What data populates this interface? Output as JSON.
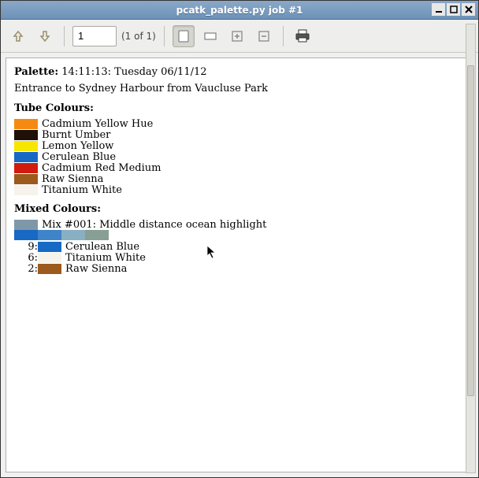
{
  "window": {
    "title": "pcatk_palette.py job #1"
  },
  "toolbar": {
    "page_value": "1",
    "page_count_label": "(1 of 1)"
  },
  "doc": {
    "palette_prefix": "Palette:",
    "timestamp": "14:11:13: Tuesday 06/11/12",
    "subtitle": "Entrance to Sydney Harbour from Vaucluse Park",
    "tube_heading": "Tube Colours:",
    "tube_colours": [
      {
        "name": "Cadmium Yellow Hue",
        "hex": "#f58a13"
      },
      {
        "name": "Burnt Umber",
        "hex": "#1f1108"
      },
      {
        "name": "Lemon Yellow",
        "hex": "#f6e600"
      },
      {
        "name": "Cerulean Blue",
        "hex": "#1769c4"
      },
      {
        "name": "Cadmium Red Medium",
        "hex": "#d11b0f"
      },
      {
        "name": "Raw Sienna",
        "hex": "#9c5a1d"
      },
      {
        "name": "Titanium White",
        "hex": "#f5f3ec"
      }
    ],
    "mixed_heading": "Mixed Colours:",
    "mix_label": "Mix #001: Middle distance ocean highlight",
    "mix_swatch_hex": "#7f98a9",
    "gradient": [
      "#1769c4",
      "#3e84c9",
      "#88b0c2",
      "#879f94"
    ],
    "mix_parts": [
      {
        "ratio": "9:",
        "name": "Cerulean Blue",
        "hex": "#1769c4"
      },
      {
        "ratio": "6:",
        "name": "Titanium White",
        "hex": "#f5f3ec"
      },
      {
        "ratio": "2:",
        "name": "Raw Sienna",
        "hex": "#9c5a1d"
      }
    ]
  }
}
